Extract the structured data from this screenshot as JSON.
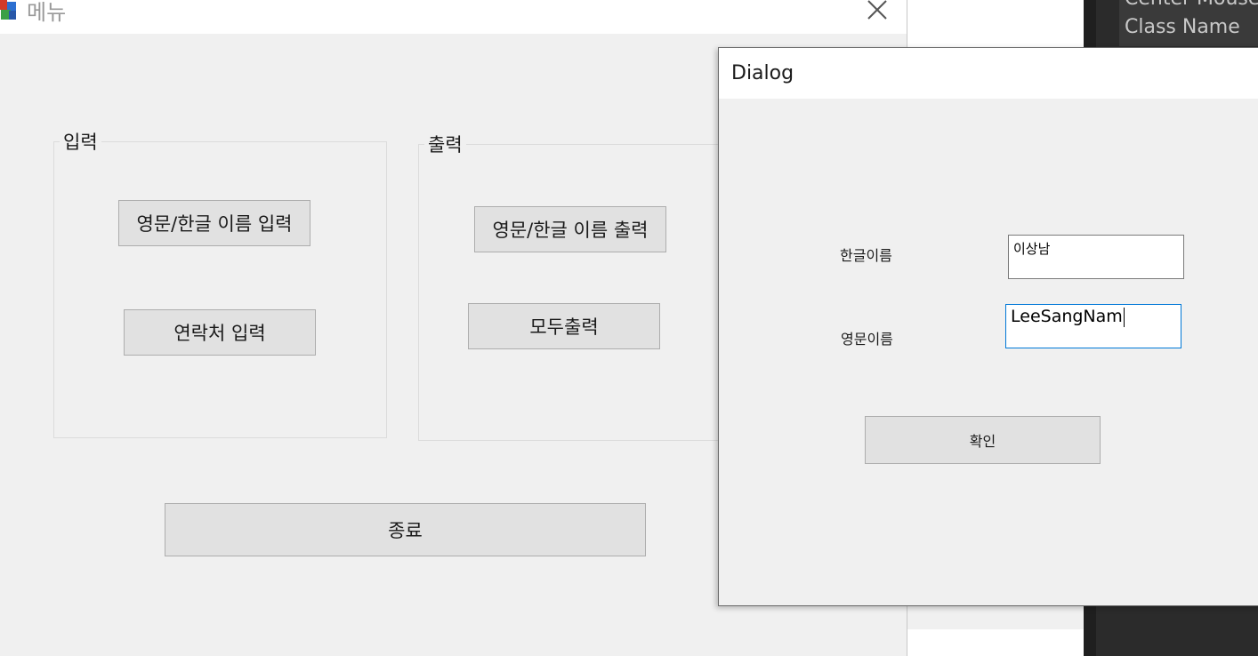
{
  "ide": {
    "row_top": "Center Mouse",
    "row_class": "Class Name"
  },
  "main": {
    "title": "메뉴",
    "input_group": {
      "legend": "입력",
      "name_input_button": "영문/한글 이름 입력",
      "contact_input_button": "연락처 입력"
    },
    "output_group": {
      "legend": "출력",
      "name_output_button": "영문/한글 이름 출력",
      "all_output_button": "모두출력"
    },
    "exit_button": "종료"
  },
  "dialog": {
    "title": "Dialog",
    "korean_name_label": "한글이름",
    "korean_name_value": "이상남",
    "english_name_label": "영문이름",
    "english_name_value": "LeeSangNam",
    "ok_button": "확인"
  },
  "colors": {
    "window_bg": "#f0f0f0",
    "button_bg": "#e1e1e1",
    "focus_border": "#0078d7",
    "ide_bg": "#2b2b2b"
  }
}
